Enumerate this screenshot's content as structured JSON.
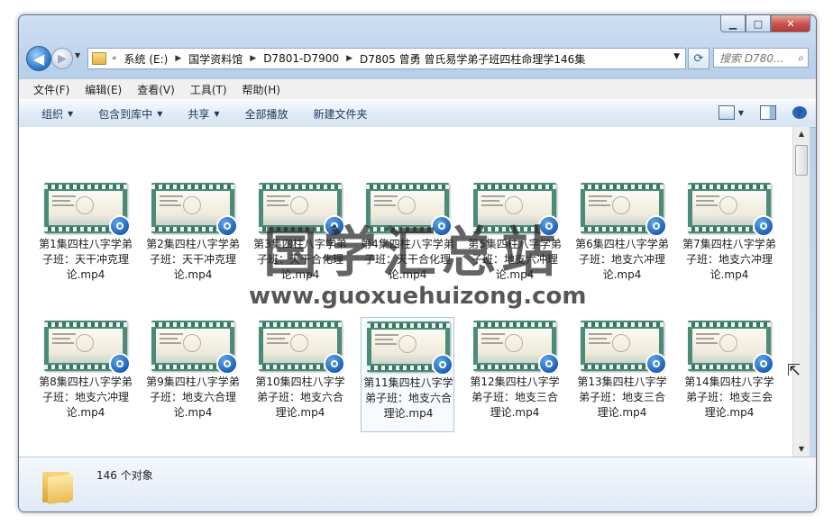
{
  "window": {
    "controls": {
      "minimize": "▁",
      "maximize": "□",
      "close": "✕"
    }
  },
  "nav": {
    "back_glyph": "◀",
    "forward_glyph": "▶",
    "address": {
      "overflow": "«",
      "segments": [
        "系统 (E:)",
        "国学资料馆",
        "D7801-D7900",
        "D7805 曾勇 曾氏易学弟子班四柱命理学146集"
      ]
    },
    "refresh_glyph": "⟳",
    "search_placeholder": "搜索 D780...",
    "search_icon": "search-icon"
  },
  "menu": [
    "文件(F)",
    "编辑(E)",
    "查看(V)",
    "工具(T)",
    "帮助(H)"
  ],
  "toolbar": {
    "organize": "组织",
    "include_library": "包含到库中",
    "share": "共享",
    "play_all": "全部播放",
    "new_folder": "新建文件夹"
  },
  "files": [
    {
      "name": "第1集四柱八字学弟子班：天干冲克理论.mp4"
    },
    {
      "name": "第2集四柱八字学弟子班：天干冲克理论.mp4"
    },
    {
      "name": "第3集四柱八字学弟子班：天干合化理论.mp4"
    },
    {
      "name": "第4集四柱八字学弟子班：天干合化理论.mp4"
    },
    {
      "name": "第5集四柱八字学弟子班：地支六冲理论.mp4"
    },
    {
      "name": "第6集四柱八字学弟子班：地支六冲理论.mp4"
    },
    {
      "name": "第7集四柱八字学弟子班：地支六冲理论.mp4"
    },
    {
      "name": "第8集四柱八字学弟子班：地支六冲理论.mp4"
    },
    {
      "name": "第9集四柱八字学弟子班：地支六合理论.mp4"
    },
    {
      "name": "第10集四柱八字学弟子班：地支六合理论.mp4"
    },
    {
      "name": "第11集四柱八字学弟子班：地支六合理论.mp4",
      "selected": true
    },
    {
      "name": "第12集四柱八字学弟子班：地支三合理论.mp4"
    },
    {
      "name": "第13集四柱八字学弟子班：地支三合理论.mp4"
    },
    {
      "name": "第14集四柱八字学弟子班：地支三会理论.mp4"
    }
  ],
  "watermark": {
    "title": "国学汇总站",
    "url": "www.guoxuehuizong.com"
  },
  "status": {
    "count": "146 个对象"
  }
}
